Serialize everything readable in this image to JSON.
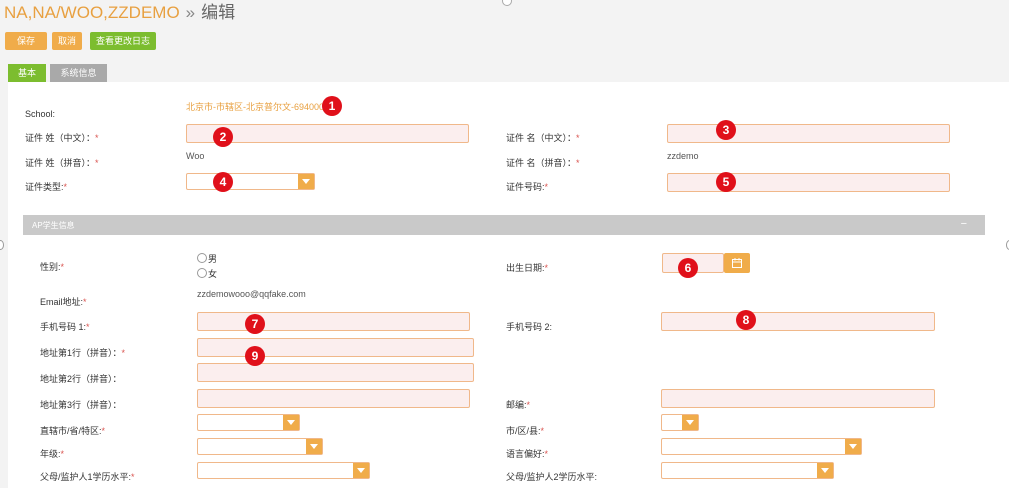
{
  "header": {
    "breadcrumb": "NA,NA/WOO,ZZDEMO",
    "separator": "»",
    "action": "编辑"
  },
  "toolbar": {
    "save": "保存",
    "cancel": "取消",
    "changelog": "查看更改日志"
  },
  "tabs": [
    {
      "label": "基本"
    },
    {
      "label": "系统信息"
    }
  ],
  "form": {
    "school_label": "School:",
    "school_value": "北京市-市辖区-北京普尔文-694000",
    "surname_cn_label": "证件 姓（中文）：",
    "given_cn_label": "证件 名（中文）：",
    "surname_py_label": "证件 姓（拼音）：",
    "surname_py_value": "Woo",
    "given_py_label": "证件 名（拼音）：",
    "given_py_value": "zzdemo",
    "id_type_label": "证件类型:",
    "id_number_label": "证件号码:"
  },
  "section": {
    "title": "AP学生信息",
    "collapse": "−"
  },
  "student": {
    "gender_label": "性别:",
    "gender_options": [
      "男",
      "女"
    ],
    "dob_label": "出生日期:",
    "email_label": "Email地址:",
    "email_value": "zzdemowooo@qqfake.com",
    "phone1_label": "手机号码 1:",
    "phone2_label": "手机号码 2:",
    "addr1_label": "地址第1行（拼音）：",
    "addr2_label": "地址第2行（拼音）：",
    "addr3_label": "地址第3行（拼音）：",
    "zip_label": "邮编:",
    "province_label": "直辖市/省/特区:",
    "city_label": "市/区/县:",
    "grade_label": "年级:",
    "language_label": "语言偏好:",
    "parent1_label": "父母/监护人1学历水平:",
    "parent2_label": "父母/监护人2学历水平:"
  },
  "required_mark": "*",
  "markers": [
    "1",
    "2",
    "3",
    "4",
    "5",
    "6",
    "7",
    "8",
    "9"
  ]
}
